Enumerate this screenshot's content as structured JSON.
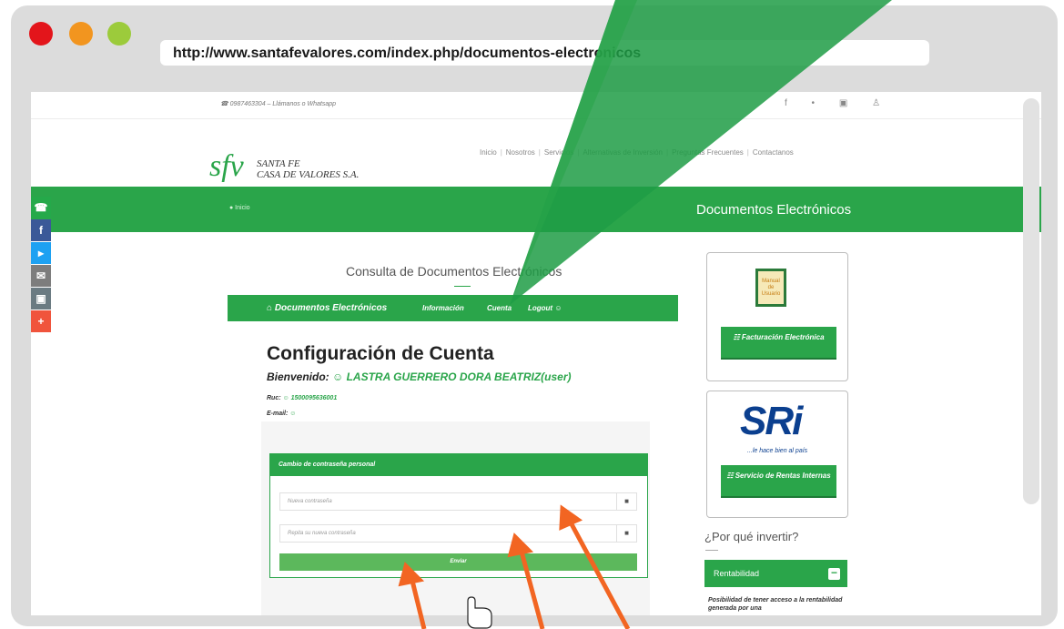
{
  "browser": {
    "url": "http://www.santafevalores.com/index.php/documentos-electronicos"
  },
  "site": {
    "phone": "☎ 0987463304 – Llámanos o Whatsapp",
    "social_icons": "f • ▣ ♙",
    "logo_mark": "sfv",
    "logo_name_line1": "SANTA FE",
    "logo_name_line2": "CASA DE VALORES S.A.",
    "nav": [
      "Inicio",
      "Nosotros",
      "Servicios",
      "Alternativas de Inversión",
      "Preguntas Frecuentes",
      "Contactanos"
    ],
    "breadcrumb": "● Inicio",
    "band_title": "Documentos Electrónicos"
  },
  "share_bar": [
    {
      "icon": "whatsapp-icon",
      "glyph": "☎",
      "color": "#25a94a"
    },
    {
      "icon": "facebook-icon",
      "glyph": "f",
      "color": "#3b5998"
    },
    {
      "icon": "twitter-icon",
      "glyph": "▸",
      "color": "#1da1f2"
    },
    {
      "icon": "email-icon",
      "glyph": "✉",
      "color": "#7d7d7d"
    },
    {
      "icon": "print-icon",
      "glyph": "▣",
      "color": "#6b7b82"
    },
    {
      "icon": "plus-icon",
      "glyph": "+",
      "color": "#f0543c"
    }
  ],
  "main": {
    "consulta_title": "Consulta de Documentos Electrónicos",
    "appbar": {
      "home": "⌂ Documentos Electrónicos",
      "info": "Información",
      "cuenta": "Cuenta",
      "logout": "Logout ☺"
    },
    "heading": "Configuración de Cuenta",
    "welcome_label": "Bienvenido:",
    "welcome_user": "☺ LASTRA GUERRERO DORA BEATRIZ(user)",
    "ruc_label": "Ruc:",
    "ruc_value": "☺ 1500095636001",
    "email_label": "E-mail:",
    "email_value": "☺",
    "form": {
      "title": "Cambio de contraseña personal",
      "new_password_placeholder": "Nueva contraseña",
      "repeat_password_placeholder": "Repita su nueva contraseña",
      "submit_label": "Enviar"
    }
  },
  "sidebar": {
    "manual_text": "Manual de Usuario",
    "facturacion_label": "☷ Facturación Electrónica",
    "sri_logo": "SRi",
    "sri_tagline": "...le hace bien al país",
    "sri_button_label": "☷ Servicio de Rentas Internas",
    "porque_title": "¿Por qué invertir?",
    "rentabilidad": "Rentabilidad",
    "rentabilidad_text": "Posibilidad de tener acceso a la rentabilidad generada por una"
  },
  "colors": {
    "brand_green": "#2aa54a",
    "arrow_orange": "#f26522"
  }
}
